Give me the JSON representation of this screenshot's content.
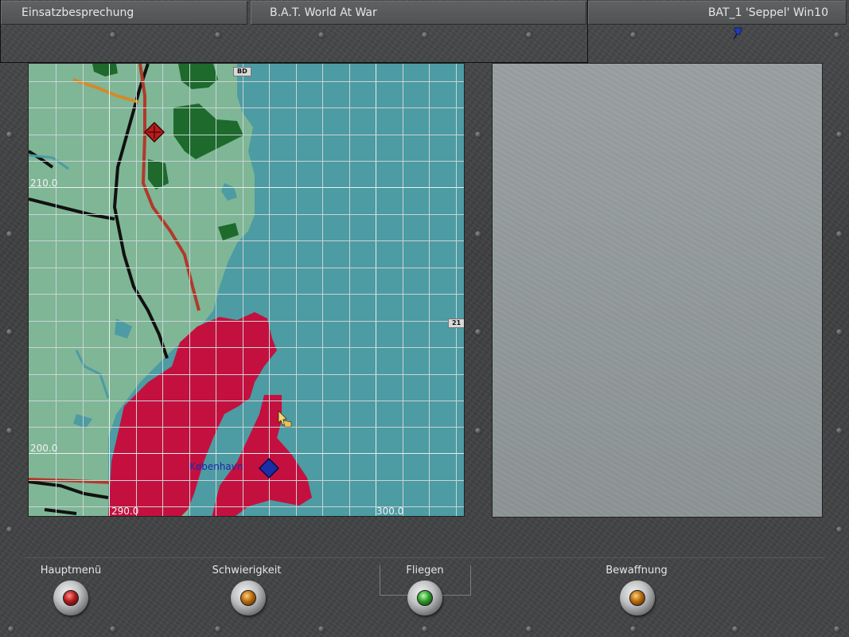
{
  "header": {
    "tab_left": "Einsatzbesprechung",
    "tab_center": "B.A.T. World At War",
    "tab_right": "BAT_1 'Seppel' Win10",
    "pin_icon": "pin-icon"
  },
  "map": {
    "grid_labels": {
      "y_top": "210.0",
      "y_bottom": "200.0",
      "x_left": "290.0",
      "x_right": "300.0"
    },
    "tags": {
      "top": "BD",
      "right": "21"
    },
    "city": "København",
    "colors": {
      "land": "#7fb696",
      "sea": "#4d9ba3",
      "city_area": "#c4103f",
      "forest": "#1d6a2c",
      "road": "#111111",
      "railway": "#b03a2a",
      "road_orange": "#d48a2a"
    },
    "markers": {
      "target": "red-diamond-target-icon",
      "city_marker": "blue-diamond-icon"
    }
  },
  "controls": [
    {
      "label": "Hauptmenü",
      "lamp": "red"
    },
    {
      "label": "Schwierigkeit",
      "lamp": "orange"
    },
    {
      "label": "Fliegen",
      "lamp": "green"
    },
    {
      "label": "Bewaffnung",
      "lamp": "orange"
    }
  ]
}
